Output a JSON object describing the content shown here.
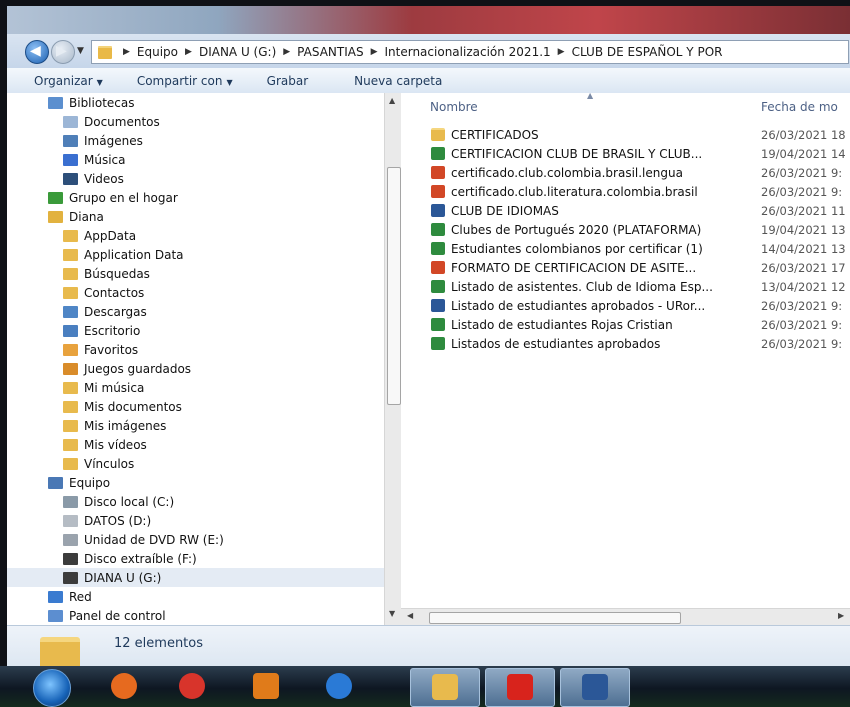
{
  "address_bar": {
    "crumbs": [
      "Equipo",
      "DIANA U (G:)",
      "PASANTIAS",
      "Internacionalización 2021.1",
      "CLUB DE ESPAÑOL Y POR"
    ]
  },
  "toolbar": {
    "organize": "Organizar",
    "share": "Compartir con",
    "burn": "Grabar",
    "new_folder": "Nueva carpeta"
  },
  "nav_tree": [
    {
      "label": "Bibliotecas",
      "icon": "libraries-icon",
      "color": "#5b8fcf"
    },
    {
      "label": "Documentos",
      "icon": "documents-icon",
      "color": "#9cb6d6"
    },
    {
      "label": "Imágenes",
      "icon": "pictures-icon",
      "color": "#4f7fb8"
    },
    {
      "label": "Música",
      "icon": "music-icon",
      "color": "#3a6fd0"
    },
    {
      "label": "Videos",
      "icon": "videos-icon",
      "color": "#2d4f7a"
    },
    {
      "label": "Grupo en el hogar",
      "icon": "homegroup-icon",
      "color": "#3a9a3a"
    },
    {
      "label": "Diana",
      "icon": "user-folder-icon",
      "color": "#e2b23f"
    },
    {
      "label": "AppData",
      "icon": "folder-icon",
      "color": "#e8ba4d"
    },
    {
      "label": "Application Data",
      "icon": "folder-icon",
      "color": "#e8ba4d"
    },
    {
      "label": "Búsquedas",
      "icon": "searches-icon",
      "color": "#e8ba4d"
    },
    {
      "label": "Contactos",
      "icon": "contacts-icon",
      "color": "#e8ba4d"
    },
    {
      "label": "Descargas",
      "icon": "downloads-icon",
      "color": "#4f86c6"
    },
    {
      "label": "Escritorio",
      "icon": "desktop-icon",
      "color": "#4a7fc0"
    },
    {
      "label": "Favoritos",
      "icon": "favorites-icon",
      "color": "#e8a23d"
    },
    {
      "label": "Juegos guardados",
      "icon": "saved-games-icon",
      "color": "#d98c2a"
    },
    {
      "label": "Mi música",
      "icon": "my-music-icon",
      "color": "#e8ba4d"
    },
    {
      "label": "Mis documentos",
      "icon": "my-documents-icon",
      "color": "#e8ba4d"
    },
    {
      "label": "Mis imágenes",
      "icon": "my-pictures-icon",
      "color": "#e8ba4d"
    },
    {
      "label": "Mis vídeos",
      "icon": "my-videos-icon",
      "color": "#e8ba4d"
    },
    {
      "label": "Vínculos",
      "icon": "links-icon",
      "color": "#e8ba4d"
    },
    {
      "label": "Equipo",
      "icon": "computer-icon",
      "color": "#4a78b5"
    },
    {
      "label": "Disco local (C:)",
      "icon": "local-disk-icon",
      "color": "#8a9aa8"
    },
    {
      "label": "DATOS (D:)",
      "icon": "drive-icon",
      "color": "#b5bcc4"
    },
    {
      "label": "Unidad de DVD RW (E:)",
      "icon": "dvd-drive-icon",
      "color": "#9aa3ad"
    },
    {
      "label": "Disco extraíble (F:)",
      "icon": "removable-disk-icon",
      "color": "#3c3c3c"
    },
    {
      "label": "DIANA U (G:)",
      "icon": "removable-disk-icon",
      "color": "#3c3c3c",
      "selected": true
    },
    {
      "label": "Red",
      "icon": "network-icon",
      "color": "#3a7bd0"
    },
    {
      "label": "Panel de control",
      "icon": "control-panel-icon",
      "color": "#5c8ed0"
    }
  ],
  "columns": {
    "name": "Nombre",
    "date": "Fecha de mo"
  },
  "files": [
    {
      "name": "CERTIFICADOS",
      "type": "folder",
      "icon": "folder-icon",
      "date": "26/03/2021 18"
    },
    {
      "name": "CERTIFICACION CLUB DE BRASIL Y CLUB...",
      "type": "excel",
      "icon": "excel-file-icon",
      "date": "19/04/2021 14"
    },
    {
      "name": "certificado.club.colombia.brasil.lengua",
      "type": "powerpoint",
      "icon": "powerpoint-file-icon",
      "date": "26/03/2021 9:"
    },
    {
      "name": "certificado.club.literatura.colombia.brasil",
      "type": "powerpoint",
      "icon": "powerpoint-file-icon",
      "date": "26/03/2021 9:"
    },
    {
      "name": "CLUB DE IDIOMAS",
      "type": "word",
      "icon": "word-file-icon",
      "date": "26/03/2021 11"
    },
    {
      "name": "Clubes de Portugués 2020 (PLATAFORMA)",
      "type": "excel",
      "icon": "excel-file-icon",
      "date": "19/04/2021 13"
    },
    {
      "name": "Estudiantes colombianos por certificar (1)",
      "type": "excel",
      "icon": "excel-file-icon",
      "date": "14/04/2021 13"
    },
    {
      "name": "FORMATO DE CERTIFICACION DE ASITE...",
      "type": "powerpoint",
      "icon": "powerpoint-file-icon",
      "date": "26/03/2021 17"
    },
    {
      "name": "Listado de asistentes. Club de Idioma Esp...",
      "type": "excel",
      "icon": "excel-file-icon",
      "date": "13/04/2021 12"
    },
    {
      "name": "Listado de estudiantes aprobados - URor...",
      "type": "word",
      "icon": "word-file-icon",
      "date": "26/03/2021 9:"
    },
    {
      "name": "Listado de estudiantes Rojas Cristian",
      "type": "excel",
      "icon": "excel-file-icon",
      "date": "26/03/2021 9:"
    },
    {
      "name": "Listados de estudiantes aprobados",
      "type": "excel",
      "icon": "excel-file-icon",
      "date": "26/03/2021 9:"
    }
  ],
  "file_colors": {
    "folder": "#e8ba4d",
    "excel": "#2e8b3e",
    "powerpoint": "#d24726",
    "word": "#2b5797"
  },
  "status": {
    "count": "12 elementos"
  },
  "taskbar": [
    {
      "name": "firefox",
      "icon": "firefox-icon",
      "color": "#e66a1f"
    },
    {
      "name": "chrome",
      "icon": "chrome-icon",
      "color": "#d8342b"
    },
    {
      "name": "media",
      "icon": "media-player-icon",
      "color": "#e07b1a"
    },
    {
      "name": "ie",
      "icon": "internet-explorer-icon",
      "color": "#2a7ad6"
    },
    {
      "name": "explorer",
      "icon": "windows-explorer-icon",
      "color": "#e8ba4d",
      "active": true
    },
    {
      "name": "acrobat",
      "icon": "acrobat-icon",
      "color": "#d8231c",
      "active": true
    },
    {
      "name": "word",
      "icon": "word-app-icon",
      "color": "#2b5797",
      "active": true
    }
  ]
}
